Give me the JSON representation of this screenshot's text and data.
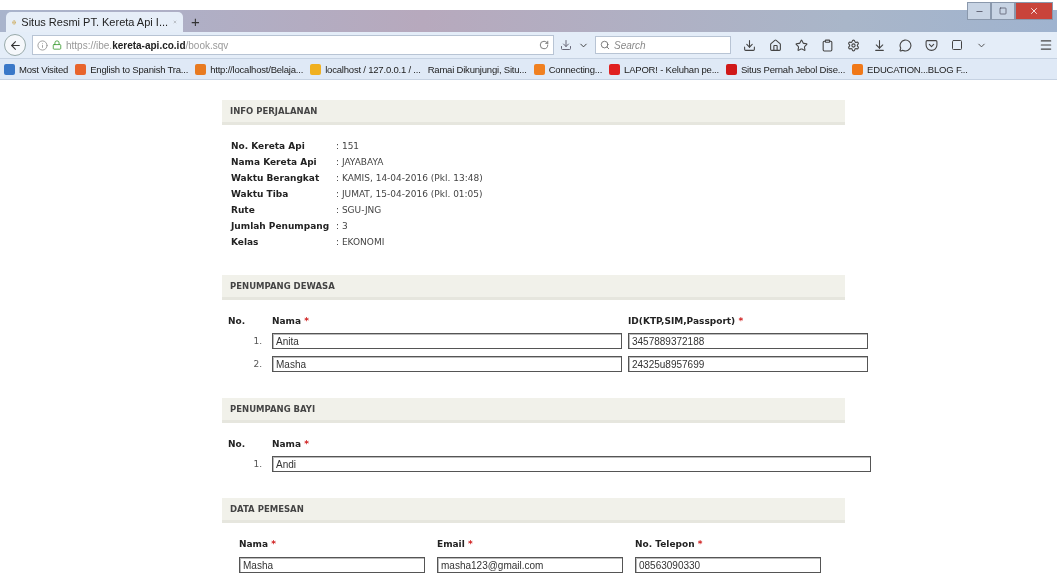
{
  "browser": {
    "tab_title": "Situs Resmi PT. Kereta Api I...",
    "new_tab": "+",
    "url": {
      "prefix": "https://ibe.",
      "domain": "kereta-api.co.id",
      "path": "/book.sqv"
    },
    "search_placeholder": "Search",
    "bookmarks": [
      {
        "label": "Most Visited",
        "color": "#3a78c8"
      },
      {
        "label": "English to Spanish Tra...",
        "color": "#e8642c"
      },
      {
        "label": "http://localhost/Belaja...",
        "color": "#e87a20"
      },
      {
        "label": "localhost / 127.0.0.1 / ...",
        "color": "#f0b020"
      },
      {
        "label": "Ramai Dikunjungi, Situ..."
      },
      {
        "label": "Connecting...",
        "color": "#f08020"
      },
      {
        "label": "LAPOR! - Keluhan pe...",
        "color": "#e02020"
      },
      {
        "label": "Situs Pernah Jebol Dise...",
        "color": "#d01818"
      },
      {
        "label": "EDUCATION...BLOG F...",
        "color": "#f07818"
      }
    ]
  },
  "sections": [
    {
      "kind": "info",
      "title": "INFO PERJALANAN",
      "separator": ":",
      "rows": [
        {
          "label": "No. Kereta Api",
          "value": "151"
        },
        {
          "label": "Nama Kereta Api",
          "value": "JAYABAYA"
        },
        {
          "label": "Waktu Berangkat",
          "value": "KAMIS, 14-04-2016 (Pkl. 13:48)"
        },
        {
          "label": "Waktu Tiba",
          "value": "JUMAT, 15-04-2016 (Pkl. 01:05)"
        },
        {
          "label": "Rute",
          "value": "SGU-JNG"
        },
        {
          "label": "Jumlah Penumpang",
          "value": "3"
        },
        {
          "label": "Kelas",
          "value": "EKONOMI"
        }
      ]
    },
    {
      "kind": "passengers",
      "title": "PENUMPANG DEWASA",
      "columns": [
        "No.",
        "Nama",
        "ID(KTP,SIM,Passport)"
      ],
      "required": "*",
      "rows": [
        {
          "no": "1.",
          "values": [
            "Anita",
            "3457889372188"
          ]
        },
        {
          "no": "2.",
          "values": [
            "Masha",
            "24325u8957699"
          ]
        }
      ]
    },
    {
      "kind": "passengers",
      "title": "PENUMPANG BAYI",
      "columns": [
        "No.",
        "Nama"
      ],
      "required": "*",
      "rows": [
        {
          "no": "1.",
          "values": [
            "Andi"
          ]
        }
      ]
    },
    {
      "kind": "form",
      "title": "DATA PEMESAN",
      "required": "*",
      "fields": [
        {
          "label": "Nama",
          "value": "Masha"
        },
        {
          "label": "Email",
          "value": "masha123@gmail.com"
        },
        {
          "label": "No. Telepon",
          "value": "08563090330"
        }
      ]
    }
  ]
}
